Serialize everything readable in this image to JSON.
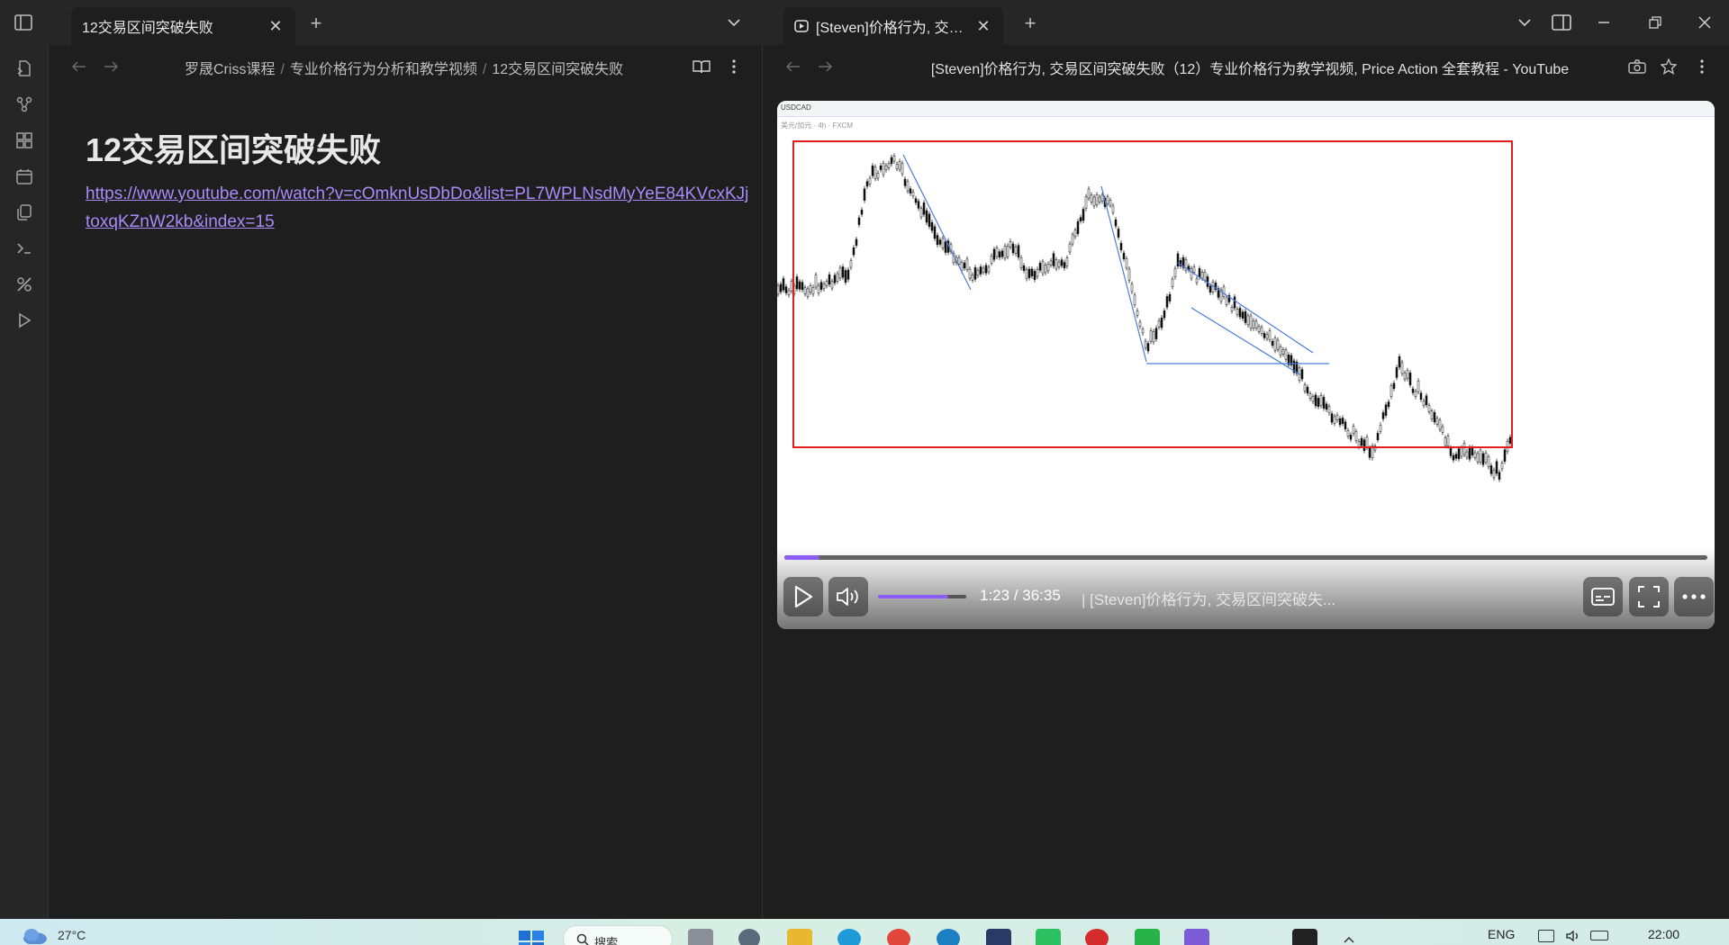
{
  "tabs": [
    {
      "label": "12交易区间突破失败"
    },
    {
      "label": "[Steven]价格行为, 交易..."
    }
  ],
  "left_pane": {
    "breadcrumb": [
      "罗晟Criss课程",
      "专业价格行为分析和教学视频",
      "12交易区间突破失败"
    ],
    "note_title": "12交易区间突破失败",
    "note_link": "https://www.youtube.com/watch?v=cOmknUsDbDo&list=PL7WPLNsdMyYeE84KVcxKJjtoxqKZnW2kb&index=15"
  },
  "right_pane": {
    "page_title": "[Steven]价格行为, 交易区间突破失败（12）专业价格行为教学视频, Price Action 全套教程 - YouTube",
    "video": {
      "time": "1:23 / 36:35",
      "title": "| [Steven]价格行为, 交易区间突破失...",
      "progress": 0.038,
      "volume": 0.8,
      "chart_header": "USDCAD",
      "chart_info": "美元/加元 · 4h · FXCM"
    }
  },
  "taskbar": {
    "weather": "27°C",
    "search_placeholder": "搜索",
    "language": "ENG",
    "clock": "22:00"
  },
  "colors": {
    "accent": "#8b5cf6",
    "link": "#a88bfa",
    "range_box": "#e01e1e",
    "trendline": "#4a7fd9"
  }
}
